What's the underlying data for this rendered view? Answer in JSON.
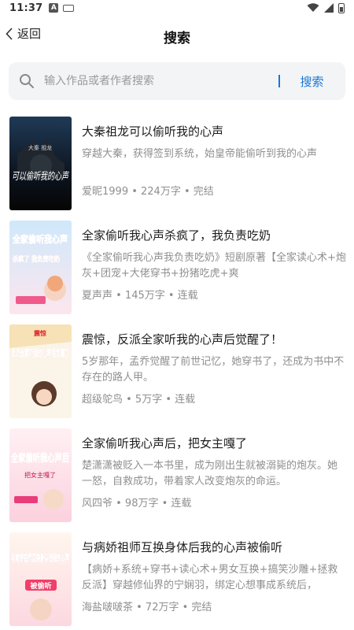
{
  "status_bar": {
    "time": "11:37"
  },
  "nav": {
    "back_label": "返回",
    "title": "搜索"
  },
  "search": {
    "placeholder": "输入作品或者作者搜索",
    "button_label": "搜索"
  },
  "books": [
    {
      "title": "大秦祖龙可以偷听我的心声",
      "description": "穿越大秦，获得签到系统，始皇帝能偷听到我的心声",
      "meta": "爱昵1999 • 224万字 • 完结",
      "cover_text": "可以偷听我的心声",
      "cover_top_text": "大秦 祖龙"
    },
    {
      "title": "全家偷听我心声杀疯了，我负责吃奶",
      "description": "《全家偷听我心声我负责吃奶》短剧原著【全家读心术+炮灰+团宠+大佬穿书+扮猪吃虎+爽",
      "meta": "夏声声 • 145万字 • 连载",
      "cover_text": "全家偷听我心声",
      "cover_top_text": "杀疯了 我负责吃奶"
    },
    {
      "title": "震惊，反派全家听我的心声后觉醒了！",
      "description": "5岁那年，孟乔觉醒了前世记忆，她穿书了，还成为书中不存在的路人甲。",
      "meta": "超级鸵鸟 • 5万字 • 连载",
      "cover_text": "反派全家听我的心声后觉醒了",
      "cover_top_text": "震惊"
    },
    {
      "title": "全家偷听我心声后，把女主嘎了",
      "description": "楚潇潇被贬入一本书里，成为刚出生就被溺毙的炮灰。她一怒，自救成功，带着家人改变炮灰的命运。",
      "meta": "风四爷 • 98万字 • 连载",
      "cover_text": "全家偷听我心声后",
      "cover_top_text": "把女主嘎了"
    },
    {
      "title": "与病娇祖师互换身体后我的心声被偷听",
      "description": "【病娇+系统+穿书+读心术+男女互换+搞笑沙雕+拯救反派】穿越修仙界的宁娴羽，绑定心想事成系统后，",
      "meta": "海盐啵啵茶 • 72万字 • 完结",
      "cover_text": "与病娇祖师互换身体后我的心声",
      "cover_top_text": "被偷听"
    }
  ],
  "colors": {
    "accent": "#1677d8",
    "search_bg": "#f3f4f6",
    "meta_text": "#8f8f8f"
  }
}
